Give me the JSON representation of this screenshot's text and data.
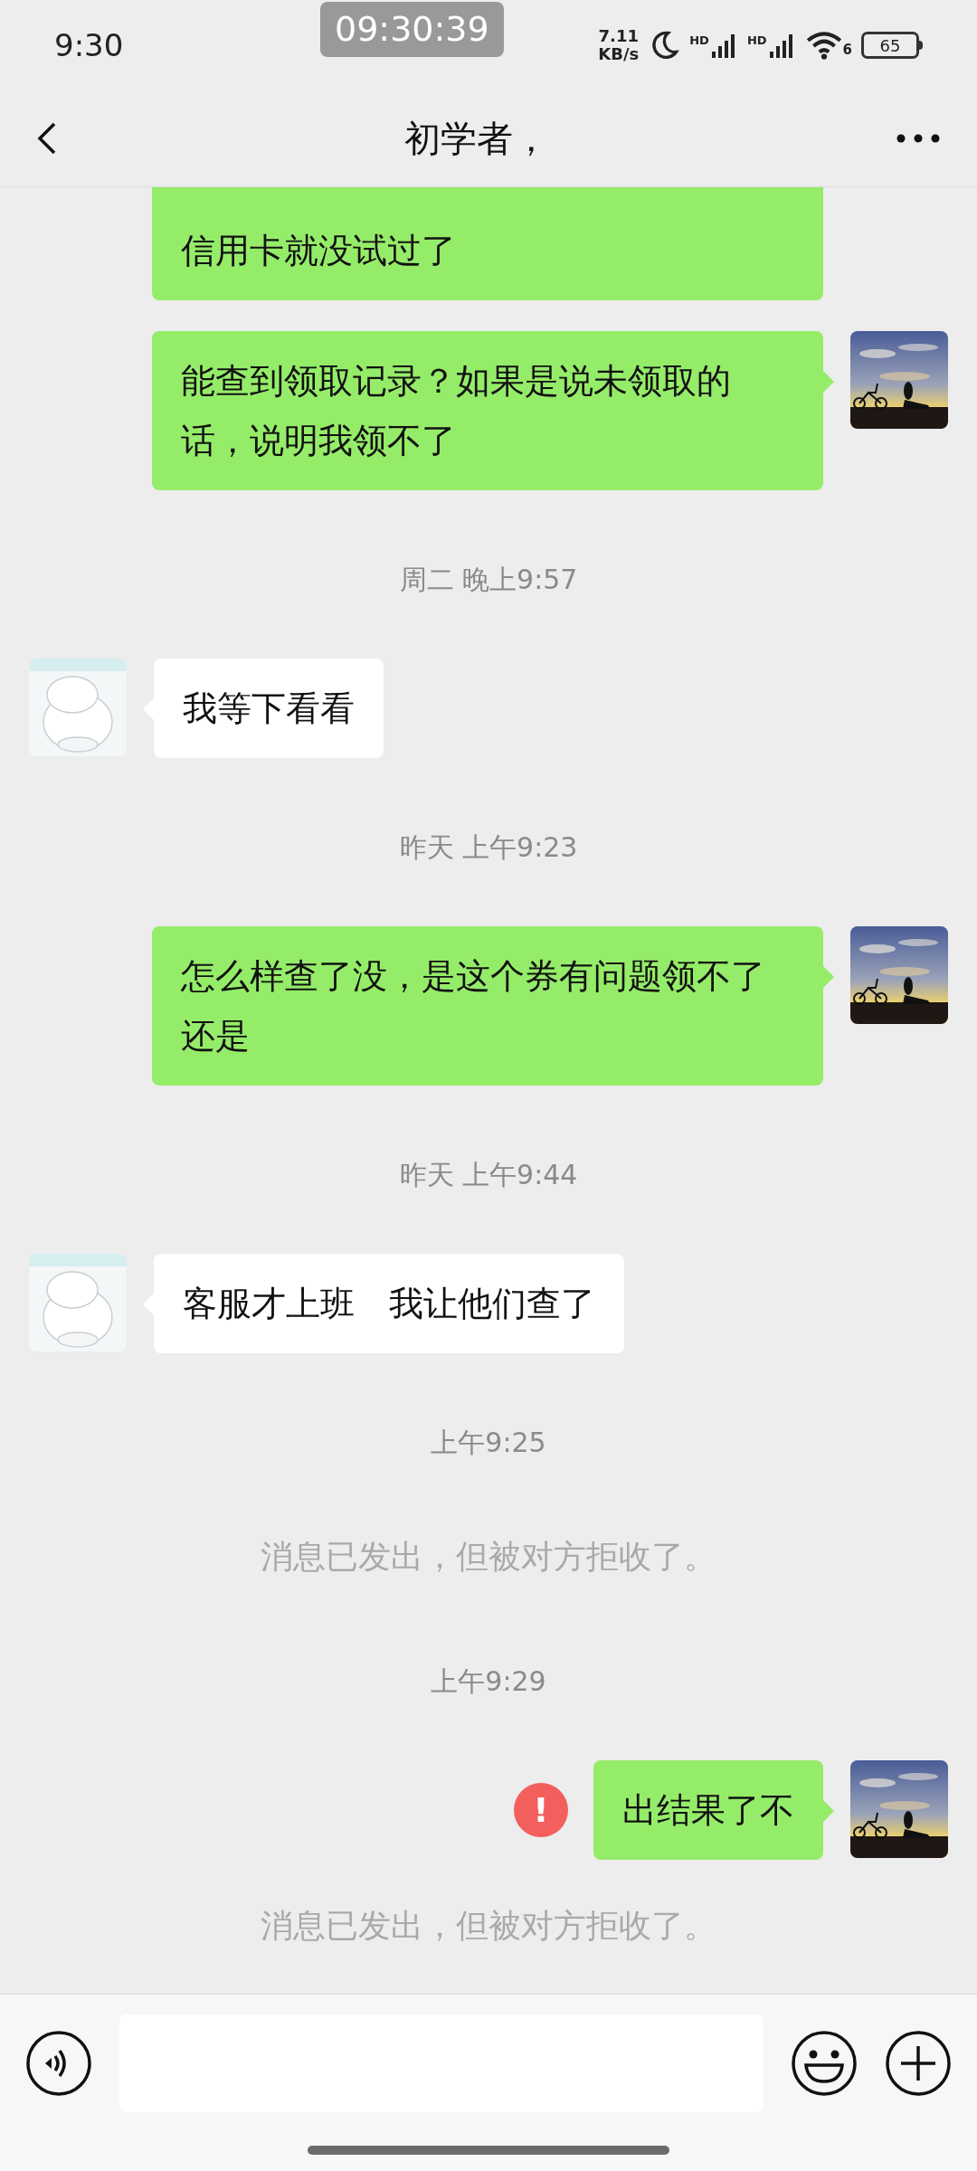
{
  "status_bar": {
    "time": "9:30",
    "clock_overlay": "09:30:39",
    "net_speed": "7.11",
    "net_unit": "KB/s",
    "sim_labels": [
      "HD",
      "HD"
    ],
    "wifi_label": "6",
    "battery": "65"
  },
  "header": {
    "title": "初学者，"
  },
  "messages": [
    {
      "kind": "sent",
      "text": "信用卡就没试过了",
      "cut_off": true,
      "failed": false
    },
    {
      "kind": "sent",
      "text": "能查到领取记录？如果是说未领取的话，说明我领不了",
      "cut_off": false,
      "failed": false
    },
    {
      "kind": "time",
      "text": "周二 晚上9:57"
    },
    {
      "kind": "received",
      "text": "我等下看看"
    },
    {
      "kind": "time",
      "text": "昨天 上午9:23"
    },
    {
      "kind": "sent",
      "text": "怎么样查了没，是这个券有问题领不了还是",
      "cut_off": false,
      "failed": false
    },
    {
      "kind": "time",
      "text": "昨天 上午9:44"
    },
    {
      "kind": "received",
      "text": "客服才上班　我让他们查了"
    },
    {
      "kind": "time",
      "text": "上午9:25"
    },
    {
      "kind": "system",
      "text": "消息已发出，但被对方拒收了。"
    },
    {
      "kind": "time",
      "text": "上午9:29"
    },
    {
      "kind": "sent",
      "text": "出结果了不",
      "cut_off": false,
      "failed": true,
      "failed_mark": "!"
    },
    {
      "kind": "system",
      "text": "消息已发出，但被对方拒收了。"
    }
  ]
}
